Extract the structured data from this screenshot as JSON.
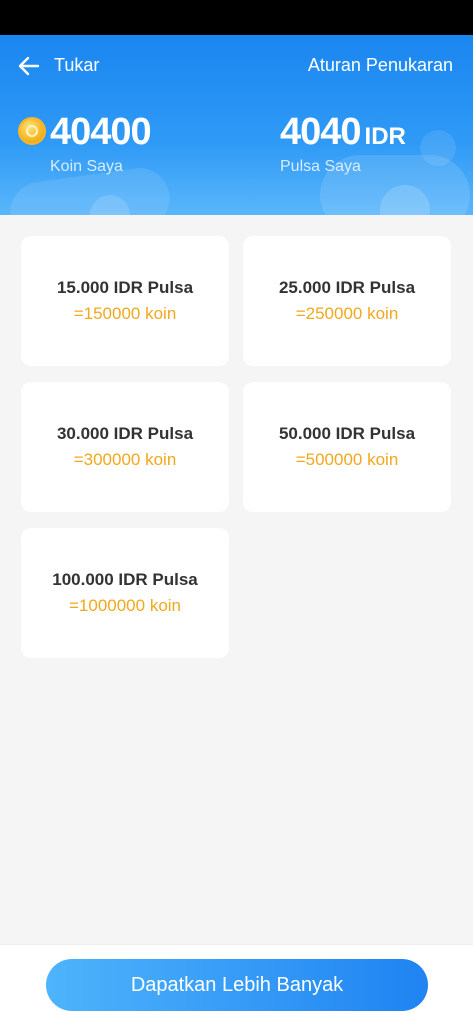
{
  "header": {
    "title": "Tukar",
    "rules_link": "Aturan Penukaran"
  },
  "balance": {
    "coins_value": "40400",
    "coins_label": "Koin Saya",
    "pulsa_value": "4040",
    "pulsa_unit": "IDR",
    "pulsa_label": "Pulsa Saya"
  },
  "rewards": [
    {
      "amount": "15.000 IDR Pulsa",
      "cost": "=150000 koin"
    },
    {
      "amount": "25.000 IDR Pulsa",
      "cost": "=250000 koin"
    },
    {
      "amount": "30.000 IDR Pulsa",
      "cost": "=300000 koin"
    },
    {
      "amount": "50.000 IDR Pulsa",
      "cost": "=500000 koin"
    },
    {
      "amount": "100.000 IDR Pulsa",
      "cost": "=1000000 koin"
    }
  ],
  "footer": {
    "cta_label": "Dapatkan Lebih Banyak"
  },
  "colors": {
    "header_blue": "#1a86f0",
    "coin_orange": "#f0a81c",
    "cta_blue": "#1f83f2"
  },
  "icons": {
    "back": "back-arrow-icon",
    "coin": "coin-icon"
  }
}
